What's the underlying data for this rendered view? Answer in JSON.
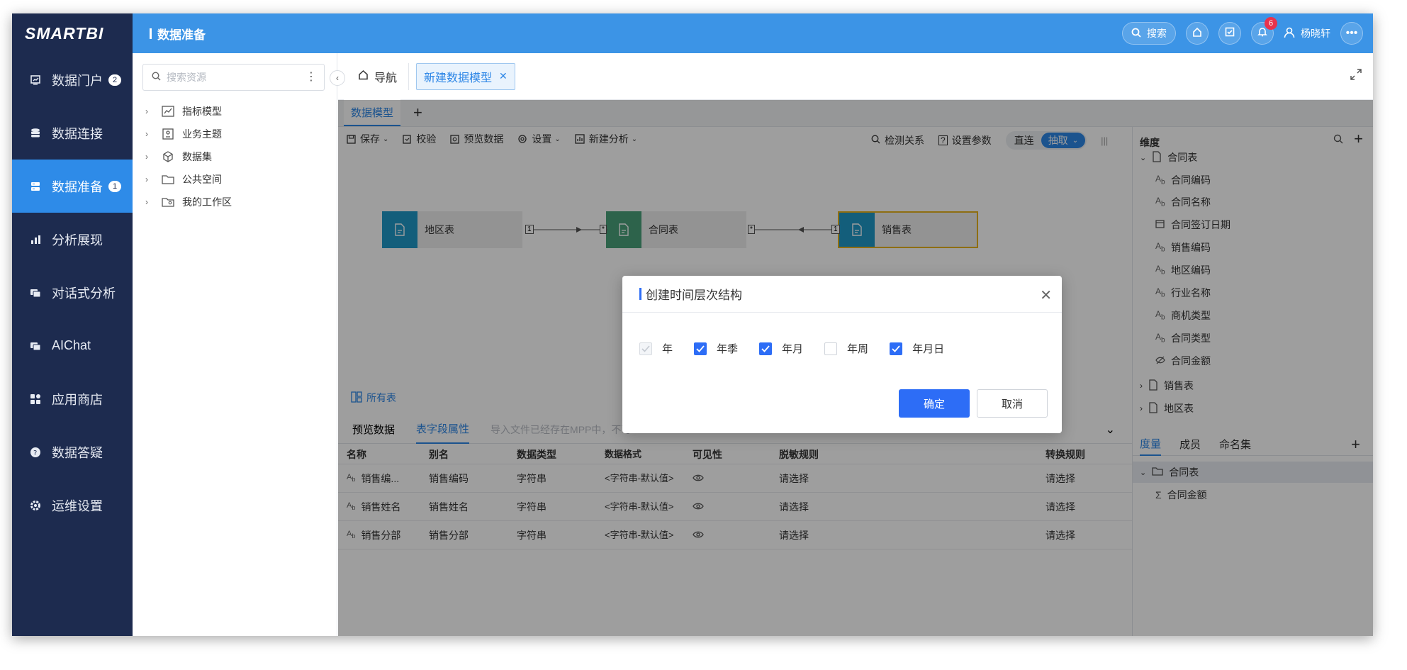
{
  "app": {
    "logo": "SMARTBI",
    "module_title": "数据准备"
  },
  "nav": [
    {
      "label": "数据门户",
      "badge": "2",
      "icon": "portal-icon"
    },
    {
      "label": "数据连接",
      "badge": "",
      "icon": "database-icon"
    },
    {
      "label": "数据准备",
      "badge": "1",
      "icon": "data-prep-icon"
    },
    {
      "label": "分析展现",
      "badge": "",
      "icon": "bar-chart-icon"
    },
    {
      "label": "对话式分析",
      "badge": "",
      "icon": "chat-analysis-icon"
    },
    {
      "label": "AIChat",
      "badge": "",
      "icon": "ai-chat-icon"
    },
    {
      "label": "应用商店",
      "badge": "",
      "icon": "app-store-icon"
    },
    {
      "label": "数据答疑",
      "badge": "",
      "icon": "help-icon"
    },
    {
      "label": "运维设置",
      "badge": "",
      "icon": "settings-icon"
    }
  ],
  "topbar": {
    "search_label": "搜索",
    "notification_count": "6",
    "user_name": "杨晓轩"
  },
  "resources": {
    "search_placeholder": "搜索资源",
    "items": [
      "指标模型",
      "业务主题",
      "数据集",
      "公共空间",
      "我的工作区"
    ]
  },
  "tabs": {
    "nav_label": "导航",
    "doc_label": "新建数据模型"
  },
  "model_tab": "数据模型",
  "toolbar": {
    "save": "保存",
    "verify": "校验",
    "preview": "预览数据",
    "settings": "设置",
    "new_analysis": "新建分析",
    "detect": "检测关系",
    "params": "设置参数",
    "direct": "直连",
    "extract": "抽取"
  },
  "canvas": {
    "tables": [
      "地区表",
      "合同表",
      "销售表"
    ],
    "rel1_left": "1",
    "rel1_right": "*",
    "rel2_left": "*",
    "rel2_right": "1",
    "all_tables": "所有表"
  },
  "subtabs": {
    "preview": "预览数据",
    "fields": "表字段属性",
    "hint": "导入文件已经存在MPP中，不可"
  },
  "grid": {
    "headers": [
      "名称",
      "别名",
      "数据类型",
      "数据格式",
      "可见性",
      "脱敏规则",
      "转换规则"
    ],
    "rows": [
      {
        "name": "销售编...",
        "alias": "销售编码",
        "type": "字符串",
        "format": "<字符串-默认值>",
        "mask": "请选择",
        "convert": "请选择"
      },
      {
        "name": "销售姓名",
        "alias": "销售姓名",
        "type": "字符串",
        "format": "<字符串-默认值>",
        "mask": "请选择",
        "convert": "请选择"
      },
      {
        "name": "销售分部",
        "alias": "销售分部",
        "type": "字符串",
        "format": "<字符串-默认值>",
        "mask": "请选择",
        "convert": "请选择"
      }
    ]
  },
  "dimensions": {
    "title": "维度",
    "root": "合同表",
    "fields": [
      "合同编码",
      "合同名称",
      "合同签订日期",
      "销售编码",
      "地区编码",
      "行业名称",
      "商机类型",
      "合同类型",
      "合同金额"
    ],
    "other_tables": [
      "销售表",
      "地区表"
    ]
  },
  "measures": {
    "tabs": [
      "度量",
      "成员",
      "命名集"
    ],
    "root": "合同表",
    "field": "合同金额"
  },
  "dialog": {
    "title": "创建时间层次结构",
    "options": [
      {
        "label": "年",
        "state": "disabled"
      },
      {
        "label": "年季",
        "state": "checked"
      },
      {
        "label": "年月",
        "state": "checked"
      },
      {
        "label": "年周",
        "state": "unchecked"
      },
      {
        "label": "年月日",
        "state": "checked"
      }
    ],
    "ok": "确定",
    "cancel": "取消"
  },
  "colors": {
    "primary": "#2d6df6",
    "topbar": "#3c94e6",
    "nav_bg": "#1d2b4f"
  }
}
